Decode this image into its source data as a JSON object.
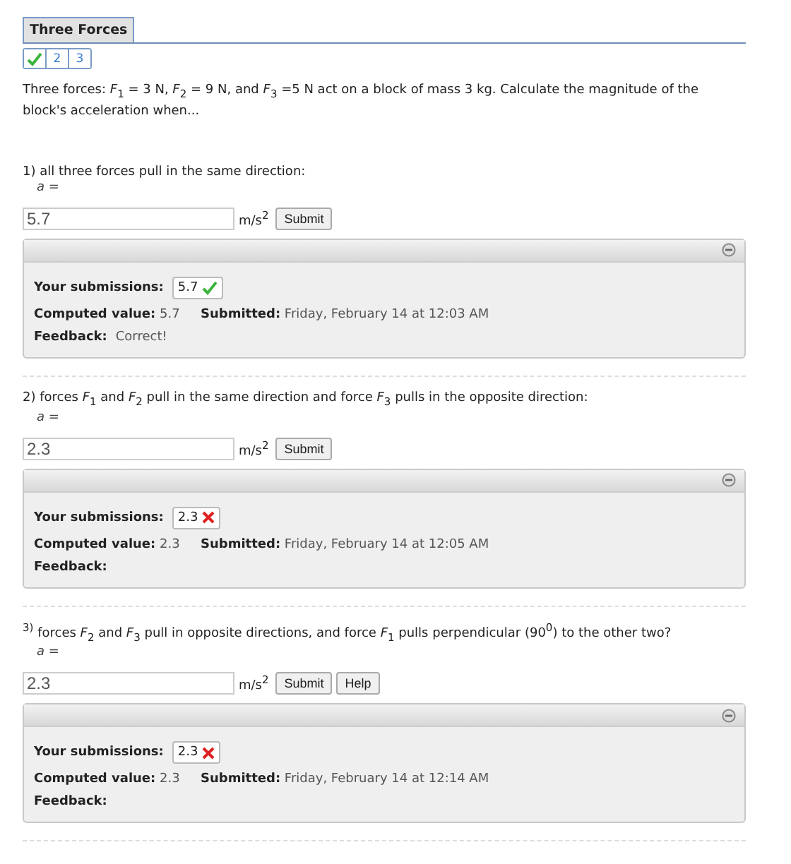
{
  "title": "Three Forces",
  "parts": [
    {
      "kind": "done",
      "selected": false
    },
    {
      "kind": "number",
      "label": "2",
      "selected": false
    },
    {
      "kind": "number",
      "label": "3",
      "selected": false
    }
  ],
  "intro": "Three forces: *F*$_{1}$ = 3 N, *F*$_{2}$ = 9 N, and *F*$_{3}$ =5 N act on a block of mass 3 kg. Calculate the magnitude of the block's acceleration when...",
  "questions": [
    {
      "prompt": "1) all three forces pull in the same direction:",
      "variable": "*a* =",
      "value": "5.7",
      "unit": "m/s$^{2}$",
      "buttons": [
        "Submit"
      ],
      "labels": {
        "submissions": "Your submissions:",
        "computed": "Computed value:",
        "submitted": "Submitted:",
        "feedback": "Feedback:"
      },
      "submission": {
        "value": "5.7",
        "correct": true
      },
      "computed": "5.7",
      "submitted": "Friday, February 14 at 12:03 AM",
      "feedback": "Correct!"
    },
    {
      "prompt": "2) forces *F*$_{1}$ and *F*$_{2}$ pull in the same direction and force *F*$_{3}$ pulls in the opposite direction:",
      "variable": "*a* =",
      "value": "2.3",
      "unit": "m/s$^{2}$",
      "buttons": [
        "Submit"
      ],
      "labels": {
        "submissions": "Your submissions:",
        "computed": "Computed value:",
        "submitted": "Submitted:",
        "feedback": "Feedback:"
      },
      "submission": {
        "value": "2.3",
        "correct": false
      },
      "computed": "2.3",
      "submitted": "Friday, February 14 at 12:05 AM"
    },
    {
      "prompt": "$^{3)}$ forces *F*$_{2}$ and *F*$_{3}$ pull in opposite directions, and force *F*$_{1}$ pulls perpendicular (90$^{0}$) to the other two?",
      "variable": "*a* =",
      "value": "2.3",
      "unit": "m/s$^{2}$",
      "buttons": [
        "Submit",
        "Help"
      ],
      "labels": {
        "submissions": "Your submissions:",
        "computed": "Computed value:",
        "submitted": "Submitted:",
        "feedback": "Feedback:"
      },
      "submission": {
        "value": "2.3",
        "correct": false
      },
      "computed": "2.3",
      "submitted": "Friday, February 14 at 12:14 AM"
    }
  ]
}
